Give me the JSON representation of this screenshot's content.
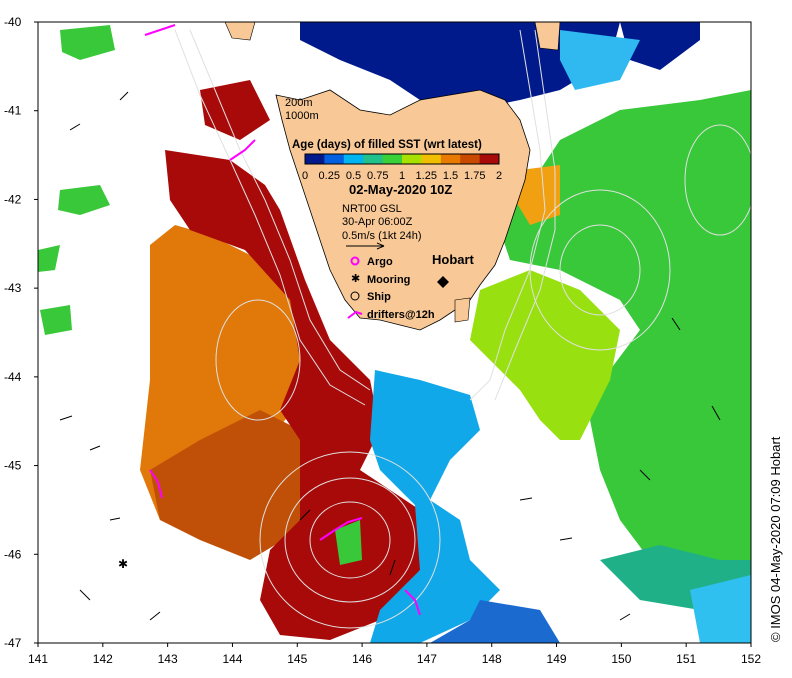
{
  "map": {
    "lat_ticks": [
      "-40",
      "-41",
      "-42",
      "-43",
      "-44",
      "-45",
      "-46",
      "-47"
    ],
    "lon_ticks": [
      "141",
      "142",
      "143",
      "144",
      "145",
      "146",
      "147",
      "148",
      "149",
      "150",
      "151",
      "152"
    ]
  },
  "legend": {
    "contour_200": "200m",
    "contour_1000": "1000m",
    "title": "Age (days) of filled SST (wrt latest)",
    "colorbar_ticks": [
      "0",
      "0.25",
      "0.5",
      "0.75",
      "1",
      "1.25",
      "1.5",
      "1.75",
      "2"
    ],
    "colorbar_colors": [
      "#001a8c",
      "#0060e0",
      "#00b4f0",
      "#22c08a",
      "#3ad03a",
      "#a8e000",
      "#f0c000",
      "#e87a00",
      "#c84a00",
      "#a80a0a"
    ],
    "date": "02-May-2020 10Z",
    "current_source": "NRT00 GSL",
    "current_time": "30-Apr 06:00Z",
    "arrow_scale": "0.5m/s (1kt 24h)",
    "city": "Hobart",
    "symbols": [
      {
        "label": "Argo",
        "icon": "argo-float-icon",
        "color": "#ff00ff"
      },
      {
        "label": "Mooring",
        "icon": "mooring-icon",
        "color": "#000000"
      },
      {
        "label": "Ship",
        "icon": "ship-icon",
        "color": "#000000"
      },
      {
        "label": "drifters@12h",
        "icon": "drifter-track-icon",
        "color": "#ff00ff"
      }
    ]
  },
  "credit": "© IMOS 04-May-2020 07:09 Hobart",
  "colors": {
    "land": "#f8c896",
    "water_no_data": "#ffffff",
    "contour": "#d8d8d8",
    "drifter": "#ff00ff"
  }
}
